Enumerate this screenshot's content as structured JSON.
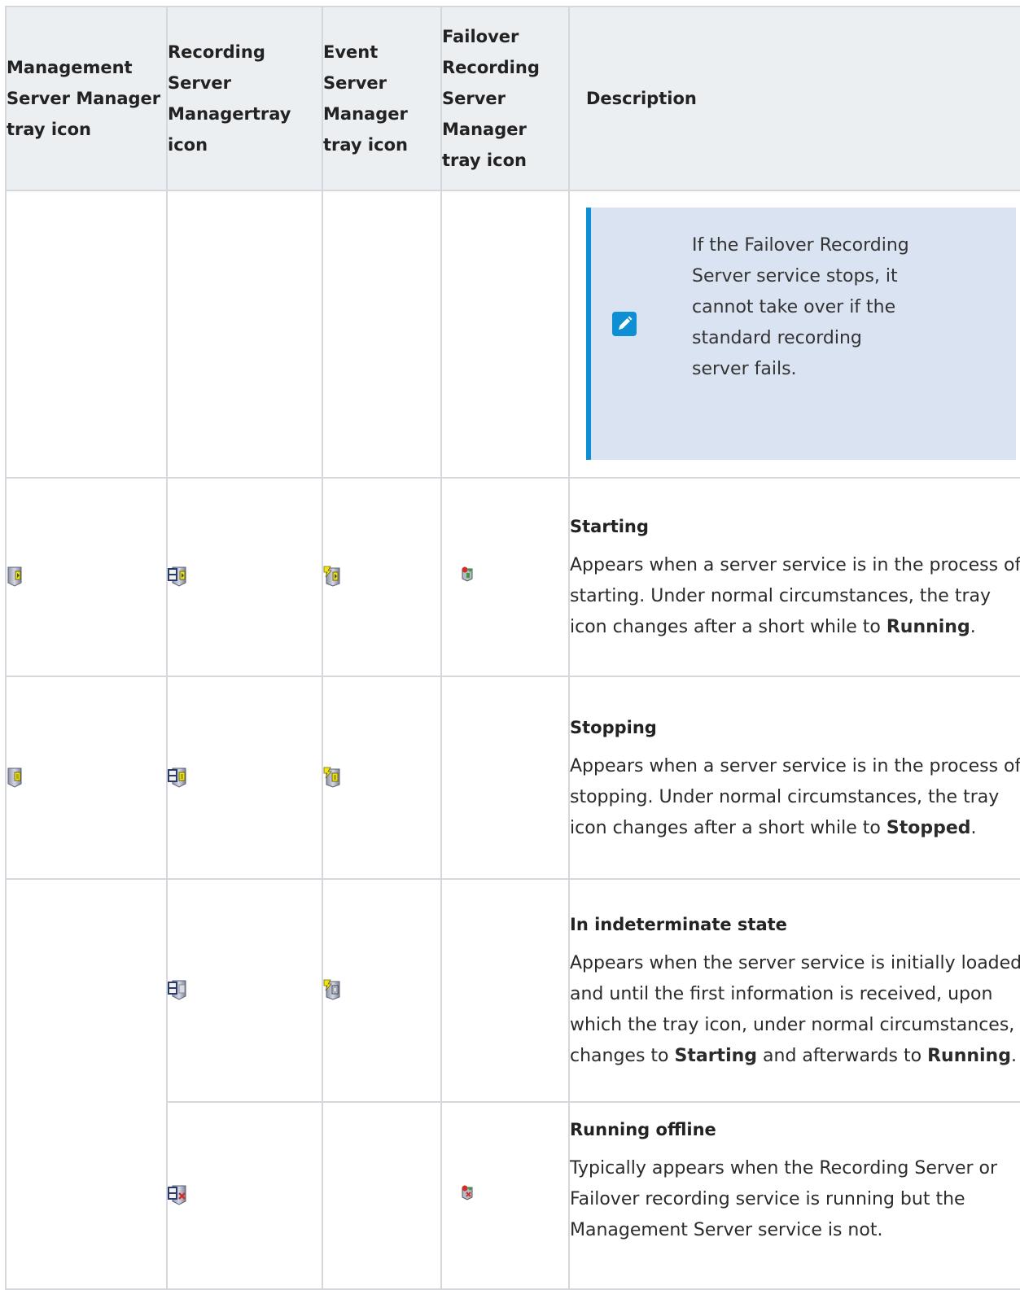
{
  "table": {
    "headers": {
      "management": "Management Server Manager tray icon",
      "recording": "Recording Server Managertray icon",
      "event": "Event Server Manager tray icon",
      "failover": "Failover Recording Server Manager tray icon",
      "description": "Description"
    },
    "note": {
      "icon": "pencil-note-icon",
      "text": "If the Failover Recording Server service stops, it cannot take over if the standard recording server fails."
    },
    "rows": [
      {
        "title": "Starting",
        "text_before": "Appears when a server service is in the process of starting. Under normal circumstances, the tray icon changes after a short while to ",
        "bold1": "Running",
        "text_after": ".",
        "icons": [
          "management-starting-icon",
          "recording-starting-icon",
          "event-starting-icon",
          "failover-starting-icon"
        ]
      },
      {
        "title": "Stopping",
        "text_before": "Appears when a server service is in the process of stopping. Under normal circumstances, the tray icon changes after a short while to ",
        "bold1": "Stopped",
        "text_after": ".",
        "icons": [
          "management-stopping-icon",
          "recording-stopping-icon",
          "event-stopping-icon"
        ]
      },
      {
        "title": "In indeterminate state",
        "text_before": "Appears when the server service is initially loaded and until the first information is received, upon which the tray icon, under normal circumstances, changes to ",
        "bold1": "Starting",
        "text_middle": " and afterwards to ",
        "bold2": "Running",
        "text_after": ".",
        "icons": [
          "recording-indeterminate-icon",
          "event-indeterminate-icon"
        ]
      },
      {
        "title": "Running offline",
        "text_before": "Typically appears when the Recording Server or Failover recording service is running but the Management Server service is not.",
        "icons": [
          "recording-offline-icon",
          "failover-offline-icon"
        ]
      }
    ]
  },
  "colors": {
    "header_bg": "#eceff2",
    "grid_line": "#d4d8dc",
    "note_bg": "#dae3f1",
    "note_accent": "#0f8fd3"
  }
}
